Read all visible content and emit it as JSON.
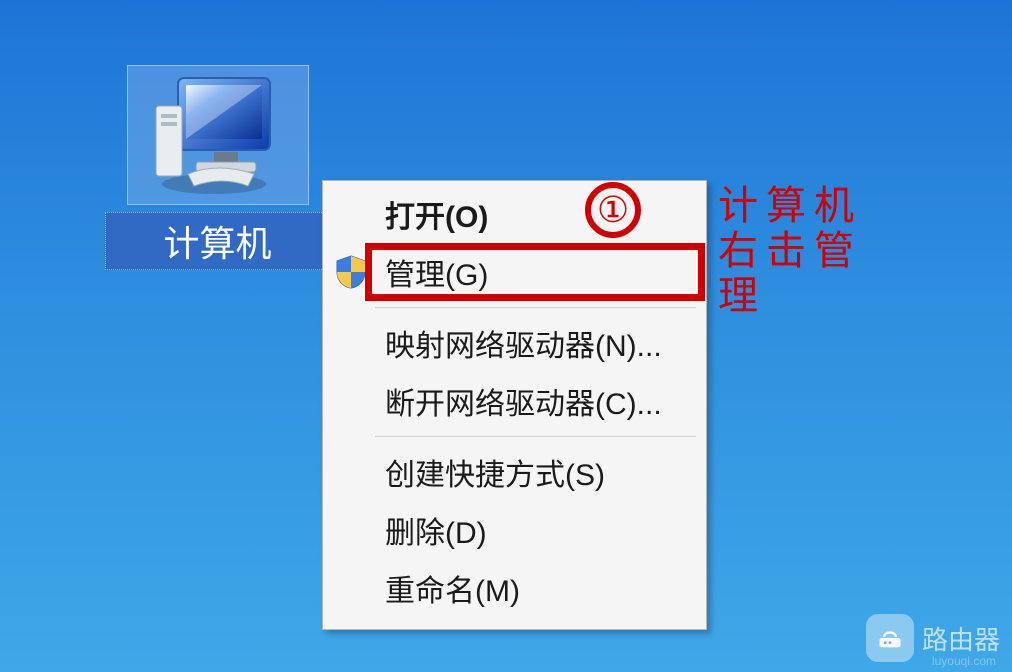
{
  "desktop": {
    "icon_label": "计算机"
  },
  "menu": {
    "items": [
      {
        "label": "打开(O)",
        "bold": true,
        "shield": false
      },
      {
        "label": "管理(G)",
        "bold": false,
        "shield": true
      },
      {
        "sep": true
      },
      {
        "label": "映射网络驱动器(N)...",
        "bold": false,
        "shield": false
      },
      {
        "label": "断开网络驱动器(C)...",
        "bold": false,
        "shield": false
      },
      {
        "sep": true
      },
      {
        "label": "创建快捷方式(S)",
        "bold": false,
        "shield": false
      },
      {
        "label": "删除(D)",
        "bold": false,
        "shield": false
      },
      {
        "label": "重命名(M)",
        "bold": false,
        "shield": false
      }
    ]
  },
  "annotation": {
    "number": "①",
    "hint": "计算机右击管理"
  },
  "watermark": {
    "brand": "路由器",
    "sub": "luyouqi.com"
  }
}
